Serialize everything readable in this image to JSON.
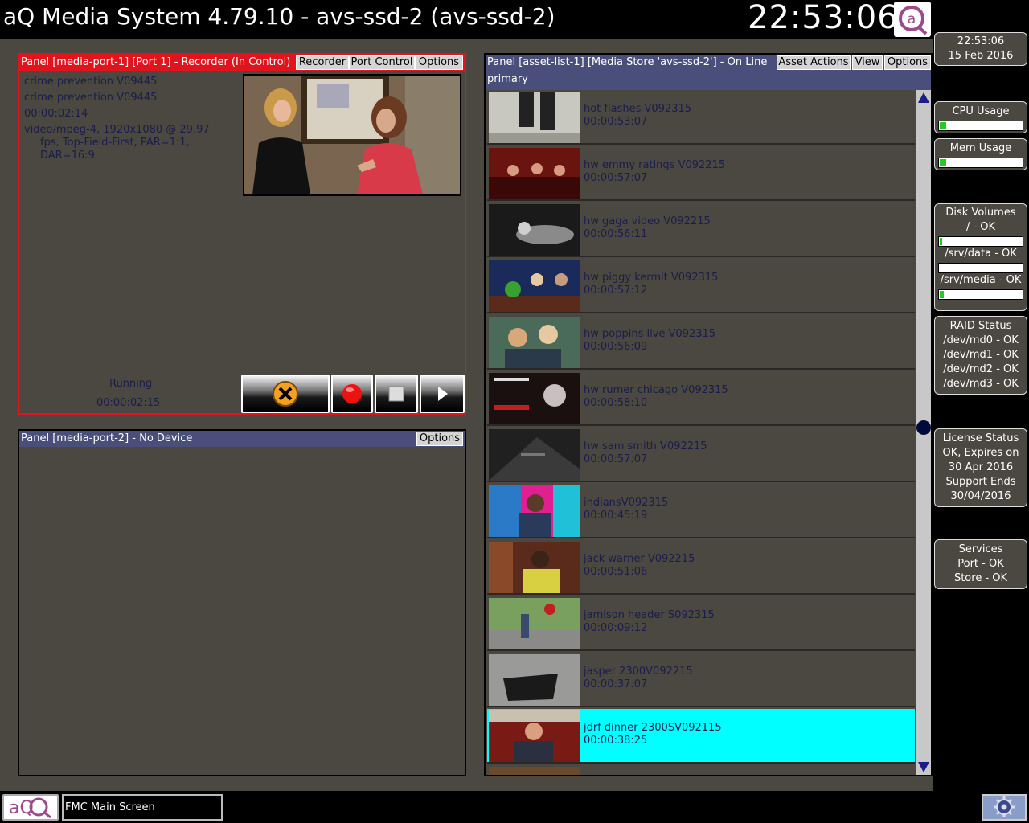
{
  "app": {
    "title": "aQ Media System 4.79.10 - avs-ssd-2 (avs-ssd-2)",
    "clock": "22:53:06"
  },
  "panel_recorder": {
    "title": "Panel [media-port-1] [Port 1] - Recorder (In Control)",
    "buttons": {
      "recorder": "Recorder",
      "port_control": "Port Control",
      "options": "Options"
    },
    "info": {
      "line1": "crime prevention V09445",
      "line2": "crime prevention V09445",
      "timecode": "00:00:02:14",
      "format_l1": "video/mpeg-4, 1920x1080 @ 29.97",
      "format_l2": "fps, Top-Field-First, PAR=1:1,",
      "format_l3": "DAR=16:9"
    },
    "status": "Running",
    "status_time": "00:00:02:15",
    "transport_icons": [
      "abort-icon",
      "record-icon",
      "stop-icon",
      "play-icon"
    ],
    "accent_color": "#e0141c"
  },
  "panel_noport": {
    "title": "Panel [media-port-2] - No Device",
    "options": "Options"
  },
  "panel_assets": {
    "title": "Panel [asset-list-1] [Media Store 'avs-ssd-2'] - On Line",
    "subtitle": "primary",
    "buttons": {
      "asset_actions": "Asset Actions",
      "view": "View",
      "options": "Options"
    },
    "assets": [
      {
        "name": "hot flashes V092315",
        "duration": "00:00:53:07"
      },
      {
        "name": "hw emmy ratings V092215",
        "duration": "00:00:57:07"
      },
      {
        "name": "hw gaga video V092215",
        "duration": "00:00:56:11"
      },
      {
        "name": "hw piggy kermit V092315",
        "duration": "00:00:57:12"
      },
      {
        "name": "hw poppins live V092315",
        "duration": "00:00:56:09"
      },
      {
        "name": "hw rumer chicago V092315",
        "duration": "00:00:58:10"
      },
      {
        "name": "hw sam smith V092215",
        "duration": "00:00:57:07"
      },
      {
        "name": "indiansV092315",
        "duration": "00:00:45:19"
      },
      {
        "name": "jack warner V092215",
        "duration": "00:00:51:06"
      },
      {
        "name": "jamison header S092315",
        "duration": "00:00:09:12"
      },
      {
        "name": "jasper 2300V092215",
        "duration": "00:00:37:07"
      },
      {
        "name": "jdrf dinner 2300SV092115",
        "duration": "00:00:38:25"
      }
    ],
    "selected_index": 11,
    "selected_color": "#00ffff"
  },
  "status": {
    "datetime": {
      "time": "22:53:06",
      "date": "15 Feb 2016"
    },
    "cpu": {
      "label": "CPU Usage",
      "level": 0.08
    },
    "mem": {
      "label": "Mem Usage",
      "level": 0.08
    },
    "disk": {
      "label": "Disk Volumes",
      "root": {
        "label": "/ - OK",
        "level": 0.03
      },
      "data": {
        "label": "/srv/data - OK",
        "level": 0.0
      },
      "media": {
        "label": "/srv/media - OK",
        "level": 0.05
      }
    },
    "raid": {
      "label": "RAID Status",
      "md0": "/dev/md0 - OK",
      "md1": "/dev/md1 - OK",
      "md2": "/dev/md2 - OK",
      "md3": "/dev/md3 - OK"
    },
    "license": {
      "l1": "License Status",
      "l2": "OK, Expires on",
      "l3": "30 Apr 2016",
      "l4": "Support Ends",
      "l5": "30/04/2016"
    },
    "services": {
      "label": "Services",
      "port": "Port - OK",
      "store": "Store - OK"
    }
  },
  "taskbar": {
    "window_label": "FMC Main Screen",
    "logo_text": "aQ"
  }
}
